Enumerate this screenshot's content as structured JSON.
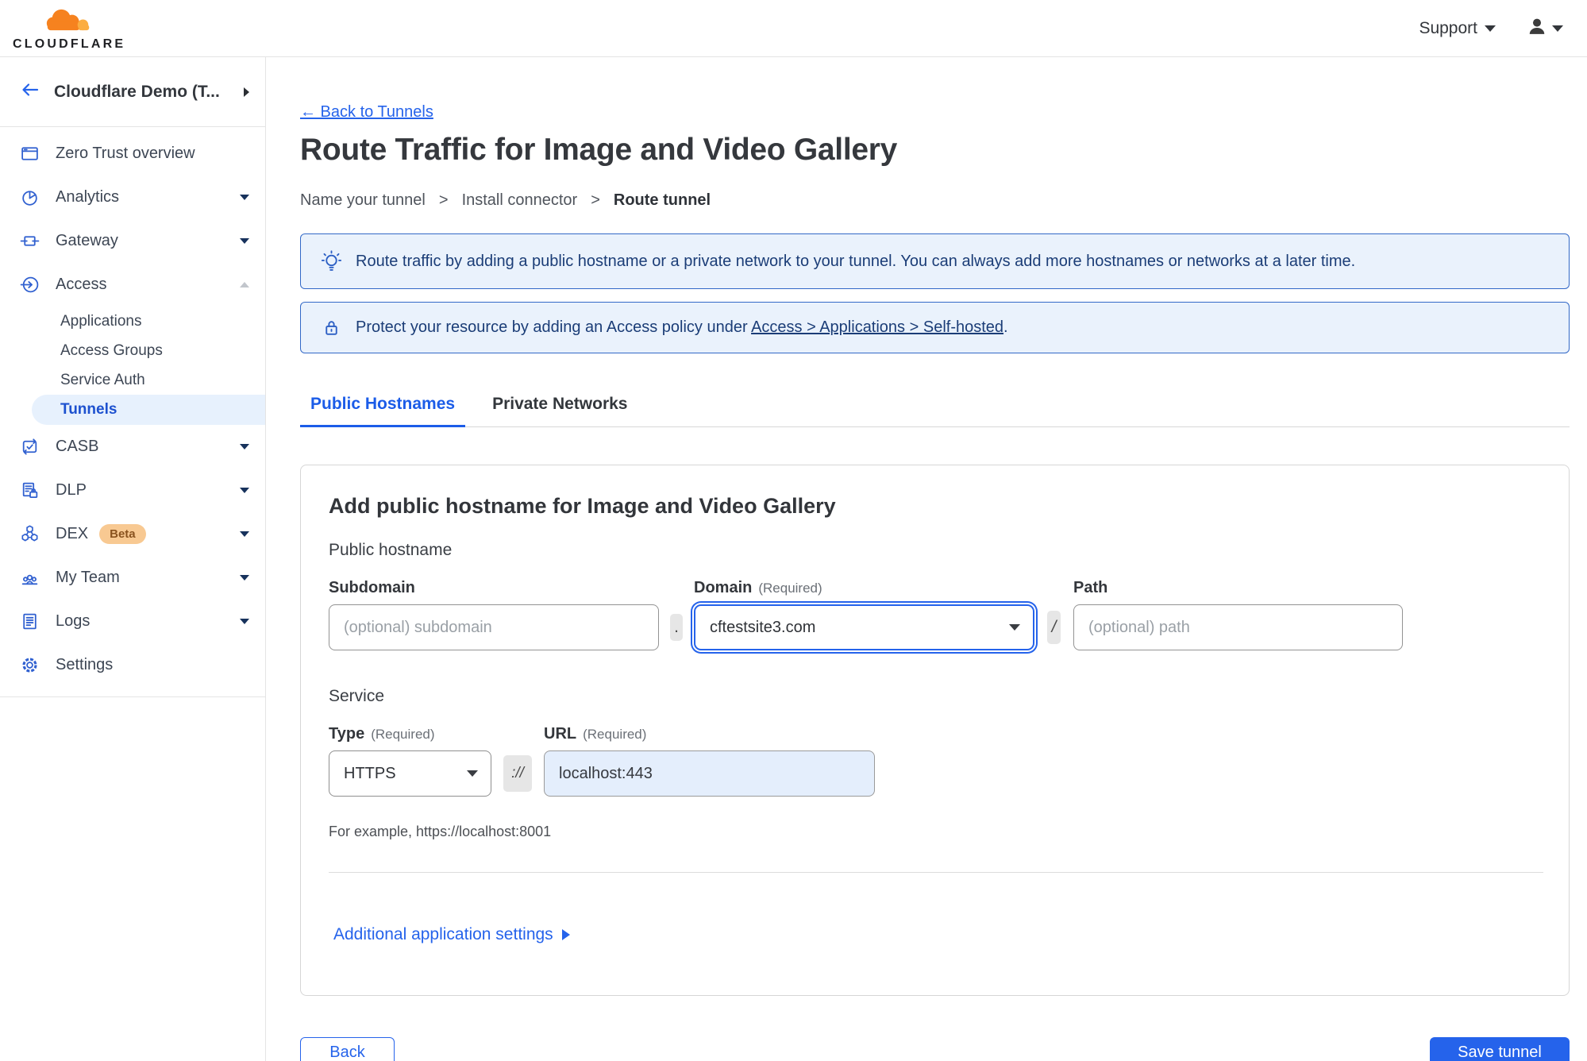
{
  "topbar": {
    "support": "Support"
  },
  "logo": {
    "wordmark": "CLOUDFLARE"
  },
  "colors": {
    "accent": "#2563eb",
    "brand_orange": "#f6821f",
    "brand_orange_light": "#fbad41",
    "banner_bg": "#eaf2fc",
    "banner_border": "#3268c7",
    "banner_text": "#1b3d77",
    "selected_pill_bg": "#e7f1fd",
    "beta_badge_bg": "#f8c992",
    "beta_badge_text": "#8a531f",
    "url_input_bg": "#e4eefc"
  },
  "icons": {
    "cloudflare-cloud": "orange cloud logo",
    "user": "person silhouette",
    "caret-down": "▾",
    "caret-up": "▴",
    "chevron-right": "▸",
    "back-arrow": "←",
    "lightbulb": "idea bulb outline",
    "lock": "padlock outline",
    "disclosure-right": "▶",
    "dropdown-arrow": "▾"
  },
  "sidebar": {
    "account": "Cloudflare Demo (T...",
    "items": [
      {
        "label": "Zero Trust overview"
      },
      {
        "label": "Analytics"
      },
      {
        "label": "Gateway"
      },
      {
        "label": "Access"
      },
      {
        "label": "CASB"
      },
      {
        "label": "DLP"
      },
      {
        "label": "DEX",
        "badge": "Beta"
      },
      {
        "label": "My Team"
      },
      {
        "label": "Logs"
      },
      {
        "label": "Settings"
      }
    ],
    "access_children": [
      {
        "label": "Applications"
      },
      {
        "label": "Access Groups"
      },
      {
        "label": "Service Auth"
      },
      {
        "label": "Tunnels"
      }
    ]
  },
  "main": {
    "back_link": "← Back to Tunnels",
    "title": "Route Traffic for Image and Video Gallery",
    "steps": {
      "s1": "Name your tunnel",
      "sep": ">",
      "s2": "Install connector",
      "s3": "Route tunnel"
    },
    "banner_info": "Route traffic by adding a public hostname or a private network to your tunnel. You can always add more hostnames or networks at a later time.",
    "banner_access": {
      "prefix": "Protect your resource by adding an Access policy under",
      "link": "Access > Applications > Self-hosted",
      "suffix": "."
    },
    "tabs": {
      "public": "Public Hostnames",
      "private": "Private Networks"
    },
    "card": {
      "heading": "Add public hostname for Image and Video Gallery",
      "section_hostname": "Public hostname",
      "subdomain_label": "Subdomain",
      "domain_label": "Domain",
      "required": "(Required)",
      "path_label": "Path",
      "subdomain_placeholder": "(optional) subdomain",
      "domain_value": "cftestsite3.com",
      "path_placeholder": "(optional) path",
      "dot": ".",
      "slash": "/",
      "section_service": "Service",
      "type_label": "Type",
      "url_label": "URL",
      "type_value": "HTTPS",
      "scheme_sep": "://",
      "url_value": "localhost:443",
      "example": "For example, https://localhost:8001",
      "additional_settings": "Additional application settings"
    },
    "buttons": {
      "back": "Back",
      "save": "Save tunnel"
    }
  }
}
